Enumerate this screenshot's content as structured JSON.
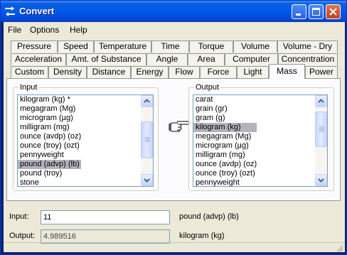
{
  "window": {
    "title": "Convert"
  },
  "menu": [
    "File",
    "Options",
    "Help"
  ],
  "tab_rows": [
    [
      "Pressure",
      "Speed",
      "Temperature",
      "Time",
      "Torque",
      "Volume",
      "Volume - Dry"
    ],
    [
      "Acceleration",
      "Amt. of Substance",
      "Angle",
      "Area",
      "Computer",
      "Concentration"
    ],
    [
      "Custom",
      "Density",
      "Distance",
      "Energy",
      "Flow",
      "Force",
      "Light",
      "Mass",
      "Power"
    ]
  ],
  "active_tab": "Mass",
  "input_group": {
    "label": "Input",
    "items": [
      "kilogram (kg) *",
      "megagram (Mg)",
      "microgram (µg)",
      "milligram (mg)",
      "ounce (avdp) (oz)",
      "ounce (troy) (ozt)",
      "pennyweight",
      "pound (advp) (lb)",
      "pound (troy)",
      "stone"
    ],
    "selected": "pound (advp) (lb)"
  },
  "output_group": {
    "label": "Output",
    "items": [
      "carat",
      "grain (gr)",
      "gram (g)",
      "kilogram (kg)",
      "megagram (Mg)",
      "microgram (µg)",
      "milligram (mg)",
      "ounce (avdp) (oz)",
      "ounce (troy) (ozt)",
      "pennyweight"
    ],
    "selected": "kilogram (kg)"
  },
  "convert_icon": "pointing-hand-icon",
  "form": {
    "input_label": "Input:",
    "input_value": "11",
    "input_unit": "pound (advp) (lb)",
    "output_label": "Output:",
    "output_value": "4.989516",
    "output_unit": "kilogram (kg)"
  },
  "colors": {
    "titlebar": "#0058ee",
    "face": "#ece9d8",
    "selection": "#b3b3bd",
    "close": "#c3401b"
  }
}
